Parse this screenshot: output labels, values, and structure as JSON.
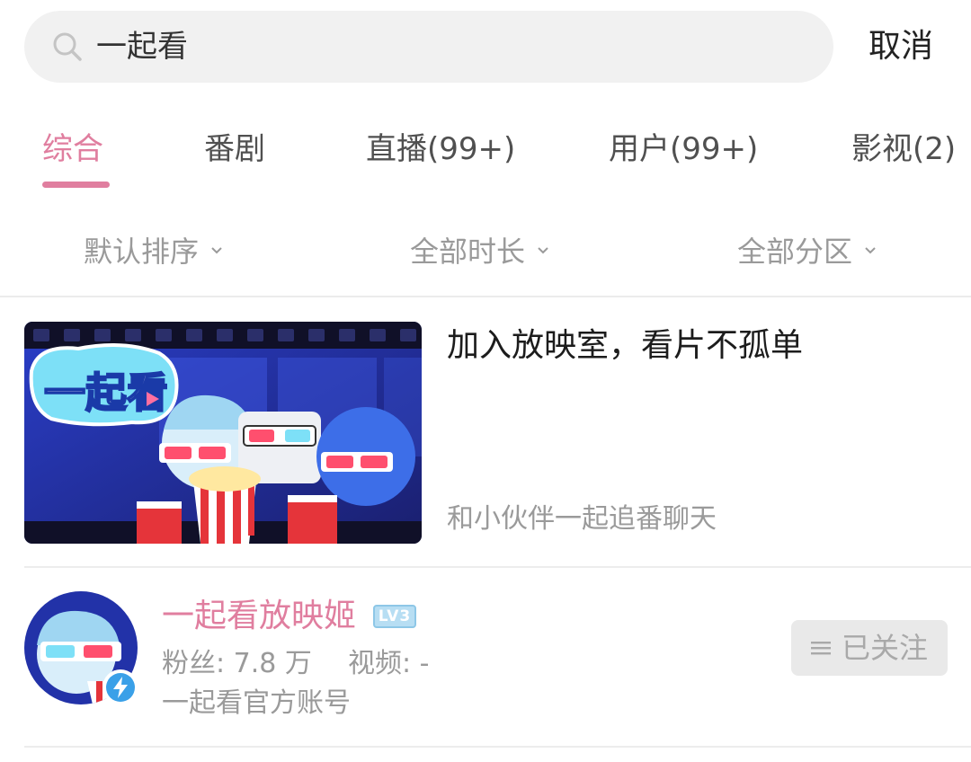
{
  "search": {
    "query": "一起看",
    "cancel_label": "取消",
    "icon": "search-icon"
  },
  "tabs": [
    {
      "label": "综合",
      "active": true
    },
    {
      "label": "番剧"
    },
    {
      "label": "直播(99+)"
    },
    {
      "label": "用户(99+)"
    },
    {
      "label": "影视(2)"
    }
  ],
  "filters": [
    {
      "label": "默认排序",
      "icon": "chevron-down-icon"
    },
    {
      "label": "全部时长",
      "icon": "chevron-down-icon"
    },
    {
      "label": "全部分区",
      "icon": "chevron-down-icon"
    }
  ],
  "result_card": {
    "thumbnail_logo": "一起看",
    "title": "加入放映室，看片不孤单",
    "subtitle": "和小伙伴一起追番聊天"
  },
  "user": {
    "name": "一起看放映姬",
    "level": "LV3",
    "fans_label": "粉丝: 7.8 万",
    "videos_label": "视频: -",
    "description": "一起看官方账号",
    "follow_label": "已关注"
  },
  "colors": {
    "accent": "#e07e9f",
    "muted_text": "#9a9a9a",
    "search_bg": "#f1f1f1",
    "follow_bg": "#e9e9e9",
    "verify_blue": "#3aa0e8"
  }
}
